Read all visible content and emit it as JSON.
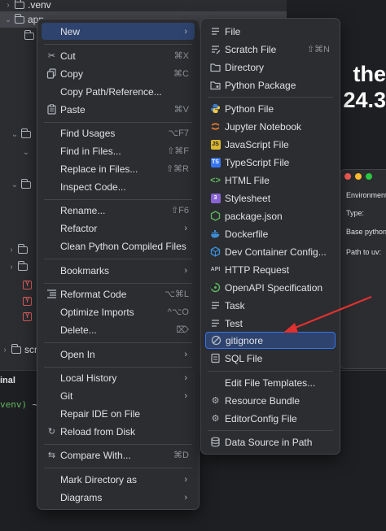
{
  "project_tree": {
    "rows": [
      {
        "label": ".venv",
        "chevron": "›"
      },
      {
        "label": "app",
        "chevron": "⌄"
      },
      {
        "label": "",
        "chevron": ""
      },
      {
        "label": "scr",
        "chevron": "›"
      }
    ]
  },
  "editor": {
    "headline_1": "the",
    "headline_2": "24.3"
  },
  "dialog": {
    "labels": [
      "Environment",
      "Type:",
      "Base python",
      "Path to uv:"
    ]
  },
  "terminal": {
    "tab_label": "inal",
    "prompt_venv": "venv)",
    "prompt_rest": " ~"
  },
  "context_menu": {
    "items": [
      {
        "label": "New",
        "shortcut": "",
        "submenu": true,
        "icon": ""
      },
      {
        "label": "Cut",
        "shortcut": "⌘X",
        "submenu": false,
        "icon": "scissors-icon"
      },
      {
        "label": "Copy",
        "shortcut": "⌘C",
        "submenu": false,
        "icon": "copy-icon"
      },
      {
        "label": "Copy Path/Reference...",
        "shortcut": "",
        "submenu": false,
        "icon": ""
      },
      {
        "label": "Paste",
        "shortcut": "⌘V",
        "submenu": false,
        "icon": "paste-icon"
      },
      {
        "label": "Find Usages",
        "shortcut": "⌥F7",
        "submenu": false,
        "icon": ""
      },
      {
        "label": "Find in Files...",
        "shortcut": "⇧⌘F",
        "submenu": false,
        "icon": ""
      },
      {
        "label": "Replace in Files...",
        "shortcut": "⇧⌘R",
        "submenu": false,
        "icon": ""
      },
      {
        "label": "Inspect Code...",
        "shortcut": "",
        "submenu": false,
        "icon": ""
      },
      {
        "label": "Rename...",
        "shortcut": "⇧F6",
        "submenu": false,
        "icon": ""
      },
      {
        "label": "Refactor",
        "shortcut": "",
        "submenu": true,
        "icon": ""
      },
      {
        "label": "Clean Python Compiled Files",
        "shortcut": "",
        "submenu": false,
        "icon": ""
      },
      {
        "label": "Bookmarks",
        "shortcut": "",
        "submenu": true,
        "icon": ""
      },
      {
        "label": "Reformat Code",
        "shortcut": "⌥⌘L",
        "submenu": false,
        "icon": "reformat-icon"
      },
      {
        "label": "Optimize Imports",
        "shortcut": "^⌥O",
        "submenu": false,
        "icon": ""
      },
      {
        "label": "Delete...",
        "shortcut": "⌦",
        "submenu": false,
        "icon": ""
      },
      {
        "label": "Open In",
        "shortcut": "",
        "submenu": true,
        "icon": ""
      },
      {
        "label": "Local History",
        "shortcut": "",
        "submenu": true,
        "icon": ""
      },
      {
        "label": "Git",
        "shortcut": "",
        "submenu": true,
        "icon": ""
      },
      {
        "label": "Repair IDE on File",
        "shortcut": "",
        "submenu": false,
        "icon": ""
      },
      {
        "label": "Reload from Disk",
        "shortcut": "",
        "submenu": false,
        "icon": "reload-icon"
      },
      {
        "label": "Compare With...",
        "shortcut": "⌘D",
        "submenu": false,
        "icon": "compare-icon"
      },
      {
        "label": "Mark Directory as",
        "shortcut": "",
        "submenu": true,
        "icon": ""
      },
      {
        "label": "Diagrams",
        "shortcut": "",
        "submenu": true,
        "icon": ""
      }
    ]
  },
  "new_submenu": {
    "items": [
      {
        "label": "File",
        "shortcut": "",
        "icon": "file-icon"
      },
      {
        "label": "Scratch File",
        "shortcut": "⇧⌘N",
        "icon": "scratch-file-icon"
      },
      {
        "label": "Directory",
        "shortcut": "",
        "icon": "folder-icon"
      },
      {
        "label": "Python Package",
        "shortcut": "",
        "icon": "package-folder-icon"
      },
      {
        "label": "Python File",
        "shortcut": "",
        "icon": "python-icon"
      },
      {
        "label": "Jupyter Notebook",
        "shortcut": "",
        "icon": "jupyter-icon"
      },
      {
        "label": "JavaScript File",
        "shortcut": "",
        "icon": "javascript-icon"
      },
      {
        "label": "TypeScript File",
        "shortcut": "",
        "icon": "typescript-icon"
      },
      {
        "label": "HTML File",
        "shortcut": "",
        "icon": "html-icon"
      },
      {
        "label": "Stylesheet",
        "shortcut": "",
        "icon": "css-icon"
      },
      {
        "label": "package.json",
        "shortcut": "",
        "icon": "npm-icon"
      },
      {
        "label": "Dockerfile",
        "shortcut": "",
        "icon": "docker-icon"
      },
      {
        "label": "Dev Container Config...",
        "shortcut": "",
        "icon": "devcontainer-icon"
      },
      {
        "label": "HTTP Request",
        "shortcut": "",
        "icon": "api-icon"
      },
      {
        "label": "OpenAPI Specification",
        "shortcut": "",
        "icon": "openapi-icon"
      },
      {
        "label": "Task",
        "shortcut": "",
        "icon": "task-icon"
      },
      {
        "label": "Test",
        "shortcut": "",
        "icon": "test-icon"
      },
      {
        "label": "gitignore",
        "shortcut": "",
        "icon": "ignore-icon"
      },
      {
        "label": "SQL File",
        "shortcut": "",
        "icon": "sql-icon"
      },
      {
        "label": "Edit File Templates...",
        "shortcut": "",
        "icon": ""
      },
      {
        "label": "Resource Bundle",
        "shortcut": "",
        "icon": "gear-icon"
      },
      {
        "label": "EditorConfig File",
        "shortcut": "",
        "icon": "gear-icon"
      },
      {
        "label": "Data Source in Path",
        "shortcut": "",
        "icon": "database-icon"
      }
    ]
  },
  "colors": {
    "menu_bg": "#2b2d30",
    "highlight": "#2e436e",
    "highlight_border": "#3574f0",
    "annotation_arrow": "#e03131"
  }
}
